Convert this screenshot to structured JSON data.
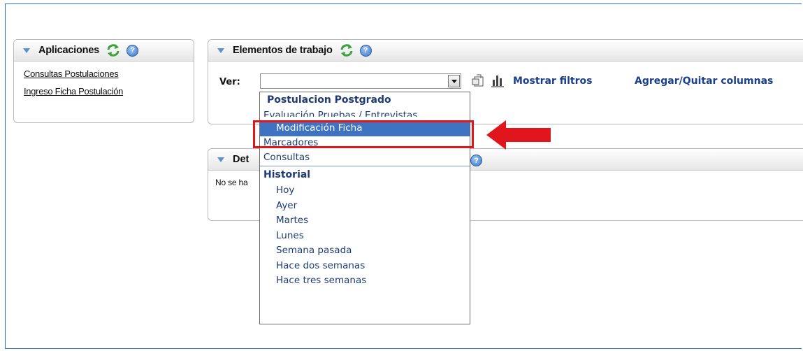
{
  "colors": {
    "accent": "#3e73c2",
    "link": "#1a3f8f",
    "highlight": "#e0161c",
    "frame": "#2e72c8"
  },
  "applications": {
    "title": "Aplicaciones",
    "links": [
      "Consultas Postulaciones",
      "Ingreso Ficha Postulación"
    ]
  },
  "work_items": {
    "title": "Elementos de trabajo",
    "ver_label": "Ver:",
    "select_value": "",
    "show_filters": "Mostrar filtros",
    "add_remove_columns": "Agregar/Quitar columnas"
  },
  "details": {
    "title_prefix": "Det",
    "body_prefix": "No se ha"
  },
  "dropdown": {
    "group1": "Postulacion Postgrado",
    "item_eval": "Evaluación Pruebas / Entrevistas",
    "item_selected": "Modificación Ficha",
    "item_marcadores": "Marcadores",
    "item_consultas": "Consultas",
    "group2": "Historial",
    "history": [
      "Hoy",
      "Ayer",
      "Martes",
      "Lunes",
      "Semana pasada",
      "Hace dos semanas",
      "Hace tres semanas"
    ]
  },
  "icons": {
    "collapse": "triangle-down-icon",
    "refresh": "refresh-icon",
    "help": "help-icon",
    "export": "export-icon",
    "chart": "chart-icon",
    "callout_arrow": "left-arrow-icon"
  }
}
